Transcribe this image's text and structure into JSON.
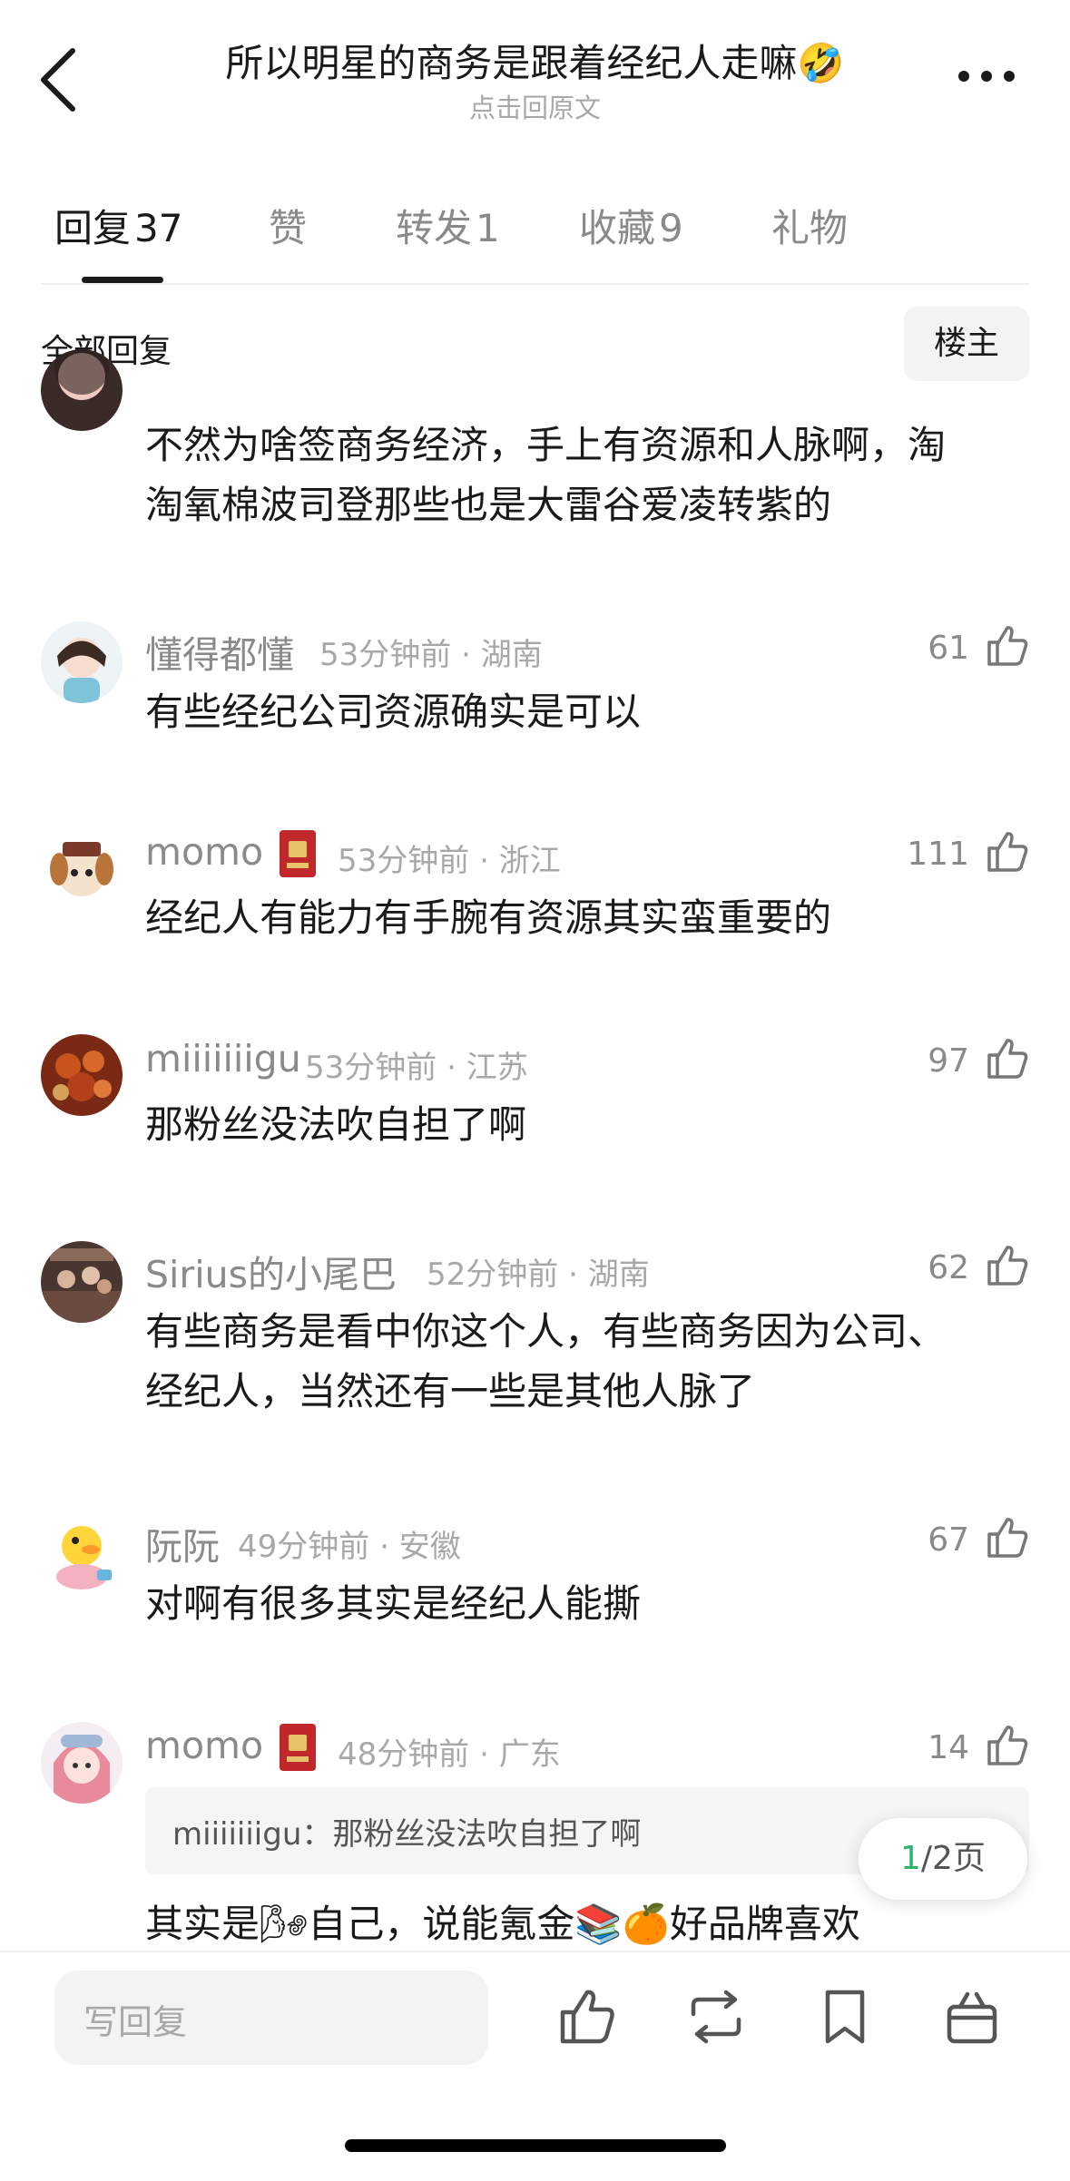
{
  "header": {
    "title": "所以明星的商务是跟着经纪人走嘛🤣",
    "subtitle": "点击回原文"
  },
  "tabs": [
    {
      "label": "回复",
      "count": "37"
    },
    {
      "label": "赞",
      "count": ""
    },
    {
      "label": "转发",
      "count": "1"
    },
    {
      "label": "收藏",
      "count": "9"
    },
    {
      "label": "礼物",
      "count": ""
    }
  ],
  "section": {
    "all_replies": "全部回复",
    "op_button": "楼主"
  },
  "partial_comment": {
    "text": "不然为啥签商务经济，手上有资源和人脉啊，淘淘氧棉波司登那些也是大雷谷爱凌转紫的"
  },
  "comments": [
    {
      "user": "懂得都懂",
      "time": "53分钟前",
      "region": "湖南",
      "likes": "61",
      "text": "有些经纪公司资源确实是可以",
      "avatar": "cartoon-girl"
    },
    {
      "user": "momo",
      "time": "53分钟前",
      "region": "浙江",
      "likes": "111",
      "text": "经纪人有能力有手腕有资源其实蛮重要的",
      "avatar": "dog",
      "badge": "red-book-badge"
    },
    {
      "user": "miiiiiiigu",
      "time": "53分钟前",
      "region": "江苏",
      "likes": "97",
      "text": "那粉丝没法吹自担了啊",
      "avatar": "food"
    },
    {
      "user": "Sirius的小尾巴",
      "time": "52分钟前",
      "region": "湖南",
      "likes": "62",
      "text": "有些商务是看中你这个人，有些商务因为公司、经纪人，当然还有一些是其他人脉了",
      "avatar": "group-photo"
    },
    {
      "user": "阮阮",
      "time": "49分钟前",
      "region": "安徽",
      "likes": "67",
      "text": "对啊有很多其实是经纪人能撕",
      "avatar": "duck"
    },
    {
      "user": "momo",
      "time": "48分钟前",
      "region": "广东",
      "likes": "14",
      "text": "其实是🌬自己，说能氪金📚🍊好品牌喜欢",
      "avatar": "anime-girl",
      "badge": "red-book-badge",
      "quote": {
        "user": "miiiiiiigu",
        "text": "那粉丝没法吹自担了啊"
      }
    }
  ],
  "pager": {
    "current": "1",
    "total": "/2页"
  },
  "bottom_bar": {
    "reply_placeholder": "写回复"
  },
  "colors": {
    "accent_green": "#2db36b",
    "muted_text": "#8a8a8a"
  }
}
